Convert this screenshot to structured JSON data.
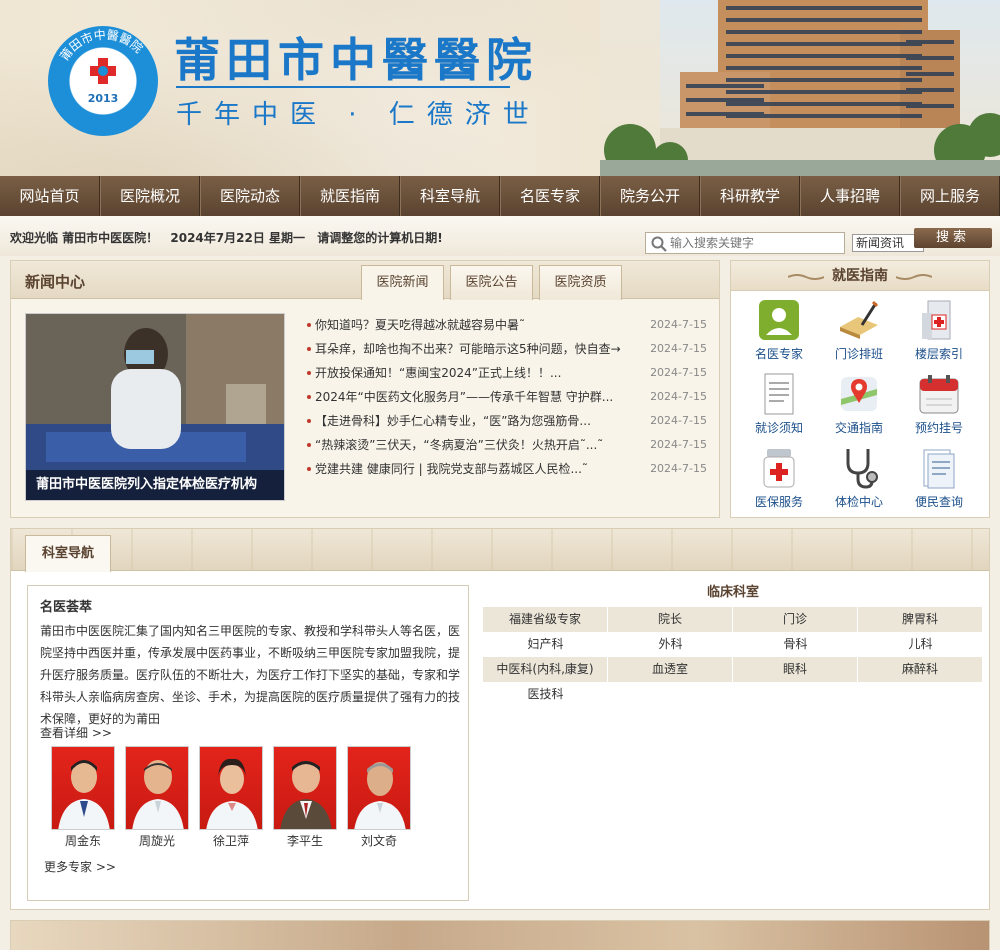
{
  "header": {
    "hospital_name": "莆田市中醫醫院",
    "slogan": "千年中医 · 仁德济世",
    "logo_text": "莆田市中醫醫院",
    "logo_year": "2013"
  },
  "nav": {
    "items": [
      "网站首页",
      "医院概况",
      "医院动态",
      "就医指南",
      "科室导航",
      "名医专家",
      "院务公开",
      "科研教学",
      "人事招聘",
      "网上服务"
    ]
  },
  "welcome": {
    "greeting": "欢迎光临 莆田市中医医院！",
    "date": "2024年7月22日 星期一",
    "notice": "请调整您的计算机日期!"
  },
  "search": {
    "placeholder": "输入搜索关键字",
    "category": "新闻资讯",
    "button": "搜索"
  },
  "news": {
    "title": "新闻中心",
    "tabs": [
      "医院新闻",
      "医院公告",
      "医院资质"
    ],
    "photo_caption": "莆田市中医医院列入指定体检医疗机构",
    "items": [
      {
        "text": "你知道吗？夏天吃得越冰就越容易中暑˜",
        "date": "2024-7-15"
      },
      {
        "text": "耳朵痒，却啥也掏不出来？可能暗示这5种问题，快自查→",
        "date": "2024-7-15"
      },
      {
        "text": "开放投保通知！“惠闽宝2024”正式上线！！...",
        "date": "2024-7-15"
      },
      {
        "text": "2024年“中医药文化服务月”——传承千年智慧 守护群...",
        "date": "2024-7-15"
      },
      {
        "text": "【走进骨科】妙手仁心精专业，“医”路为您强筋骨...",
        "date": "2024-7-15"
      },
      {
        "text": "“热辣滚烫”三伏天，“冬病夏治”三伏灸！火热开启˜...˜",
        "date": "2024-7-15"
      },
      {
        "text": "党建共建 健康同行 | 我院党支部与荔城区人民检...˜",
        "date": "2024-7-15"
      }
    ]
  },
  "guide": {
    "title": "就医指南",
    "items": [
      {
        "label": "名医专家",
        "icon": "doctor-icon"
      },
      {
        "label": "门诊排班",
        "icon": "schedule-book-icon"
      },
      {
        "label": "楼层索引",
        "icon": "building-icon"
      },
      {
        "label": "就诊须知",
        "icon": "document-icon"
      },
      {
        "label": "交通指南",
        "icon": "map-pin-icon"
      },
      {
        "label": "预约挂号",
        "icon": "calendar-icon"
      },
      {
        "label": "医保服务",
        "icon": "medicine-bottle-icon"
      },
      {
        "label": "体检中心",
        "icon": "stethoscope-icon"
      },
      {
        "label": "便民查询",
        "icon": "clipboard-icon"
      }
    ]
  },
  "departments": {
    "tab": "科室导航",
    "expert_section": {
      "title": "名医荟萃",
      "description": "莆田市中医医院汇集了国内知名三甲医院的专家、教授和学科带头人等名医，医院坚持中西医并重，传承发展中医药事业，不断吸纳三甲医院专家加盟我院，提升医疗服务质量。医疗队伍的不断壮大，为医疗工作打下坚实的基础，专家和学科带头人亲临病房查房、坐诊、手术，为提高医院的医疗质量提供了强有力的技术保障，更好的为莆田",
      "detail_link": "查看详细 >>",
      "more_link": "更多专家 >>",
      "doctors": [
        "周金东",
        "周旋光",
        "徐卫萍",
        "李平生",
        "刘文奇"
      ]
    },
    "clinical": {
      "title": "临床科室",
      "items": [
        "福建省级专家",
        "院长",
        "门诊",
        "脾胃科",
        "妇产科",
        "外科",
        "骨科",
        "儿科",
        "中医科(内科,康复)",
        "血透室",
        "眼科",
        "麻醉科",
        "医技科"
      ]
    }
  },
  "colors": {
    "nav_brown": "#5a4330",
    "brand_blue": "#1b78c8",
    "paper": "#f4efe4"
  }
}
